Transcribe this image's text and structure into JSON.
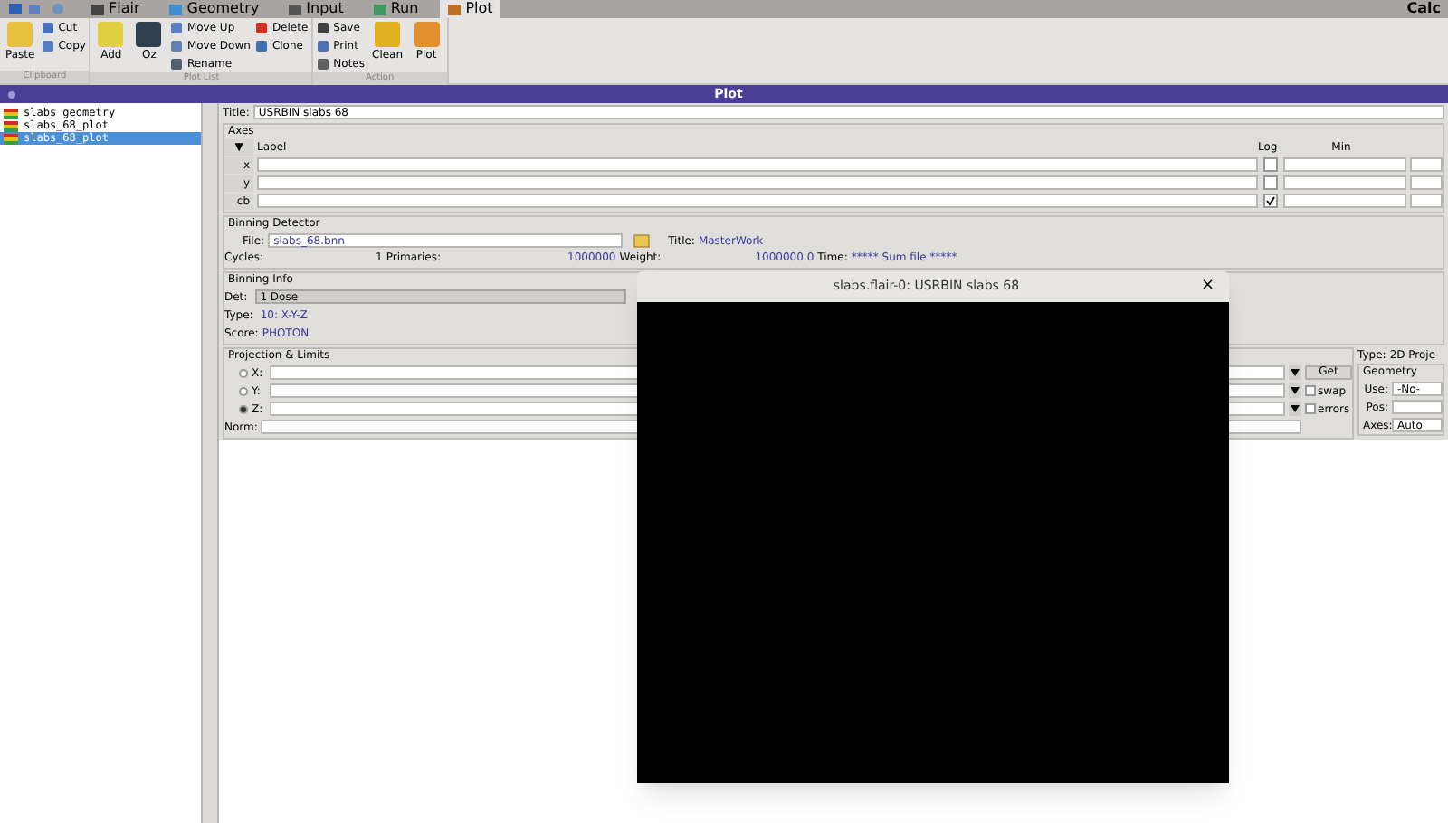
{
  "app_tabs": [
    {
      "label": "Flair",
      "selected": false
    },
    {
      "label": "Geometry",
      "selected": false
    },
    {
      "label": "Input",
      "selected": false
    },
    {
      "label": "Run",
      "selected": false
    },
    {
      "label": "Plot",
      "selected": true
    }
  ],
  "calc_label": "Calc",
  "ribbon": [
    {
      "label": "Clipboard",
      "columns": [
        [
          {
            "label": "Paste",
            "kind": "large"
          }
        ],
        [
          {
            "label": "Cut",
            "kind": "small"
          },
          {
            "label": "Copy",
            "kind": "small"
          }
        ]
      ]
    },
    {
      "label": "Plot List",
      "columns": [
        [
          {
            "label": "Add",
            "kind": "large"
          }
        ],
        [
          {
            "label": "Oz",
            "kind": "large"
          }
        ],
        [
          {
            "label": "Move Up",
            "kind": "small"
          },
          {
            "label": "Move Down",
            "kind": "small"
          },
          {
            "label": "Rename",
            "kind": "small"
          }
        ],
        [
          {
            "label": "Delete",
            "kind": "small"
          },
          {
            "label": "Clone",
            "kind": "small"
          }
        ]
      ]
    },
    {
      "label": "Action",
      "columns": [
        [
          {
            "label": "Save",
            "kind": "small"
          },
          {
            "label": "Print",
            "kind": "small"
          },
          {
            "label": "Notes",
            "kind": "small"
          }
        ],
        [
          {
            "label": "Clean",
            "kind": "large"
          }
        ],
        [
          {
            "label": "Plot",
            "kind": "large"
          }
        ]
      ]
    }
  ],
  "panel_title": "Plot",
  "tree": [
    {
      "label": "slabs_geometry",
      "selected": false
    },
    {
      "label": "slabs_68_plot",
      "selected": false
    },
    {
      "label": "slabs_68_plot",
      "selected": true
    }
  ],
  "form": {
    "title_label": "Title:",
    "title_value": "USRBIN slabs 68",
    "axes": {
      "legend": "Axes",
      "sort_glyph": "▼",
      "label_header": "Label",
      "log_header": "Log",
      "min_header": "Min",
      "rows": [
        {
          "name": "x",
          "log": false
        },
        {
          "name": "y",
          "log": false
        },
        {
          "name": "cb",
          "log": true
        }
      ]
    },
    "binning_detector": {
      "legend": "Binning Detector",
      "file_label": "File:",
      "file_value": "slabs_68.bnn",
      "title_label": "Title:",
      "title_value": "MasterWork",
      "cycles_label": "Cycles:",
      "cycles_value": "1",
      "primaries_label": "Primaries:",
      "primaries_value": "1000000",
      "weight_label": "Weight:",
      "weight_value": "1000000.0",
      "time_label": "Time:",
      "time_value": "***** Sum file *****"
    },
    "binning_info": {
      "legend": "Binning Info",
      "det_label": "Det:",
      "det_value": "1 Dose",
      "type_label": "Type:",
      "type_value": "10: X-Y-Z",
      "score_label": "Score:",
      "score_value": "PHOTON"
    },
    "projection": {
      "legend": "Projection & Limits",
      "rows": [
        {
          "label": "X:",
          "selected": false
        },
        {
          "label": "Y:",
          "selected": false
        },
        {
          "label": "Z:",
          "selected": true
        }
      ],
      "norm_label": "Norm:",
      "get_button": "Get",
      "swap": {
        "label": "swap",
        "checked": false
      },
      "errors": {
        "label": "errors",
        "checked": false
      }
    },
    "side": {
      "type_label": "Type:",
      "type_value": "2D Proje",
      "geometry_legend": "Geometry",
      "use_label": "Use:",
      "use_value": "-No-",
      "pos_label": "Pos:",
      "axes_label": "Axes:",
      "axes_value": "Auto"
    }
  },
  "plot_window": {
    "title": "slabs.flair-0: USRBIN slabs 68",
    "close": "×"
  }
}
